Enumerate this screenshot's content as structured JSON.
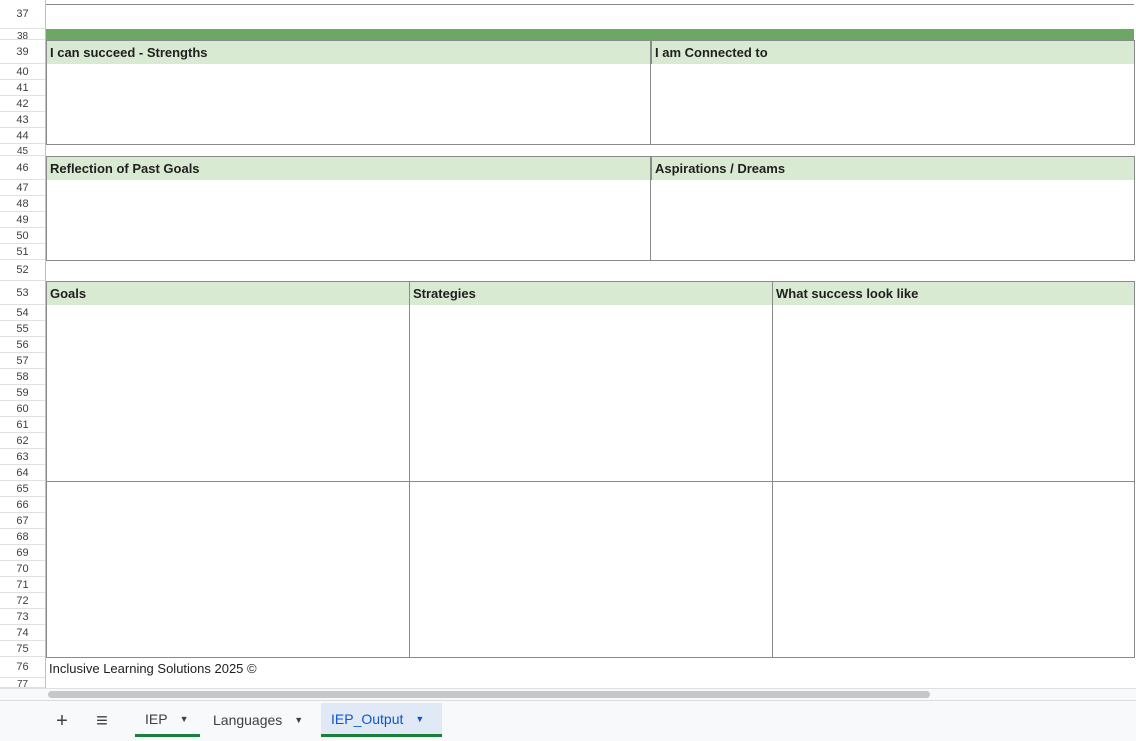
{
  "rows": [
    "37",
    "38",
    "39",
    "40",
    "41",
    "42",
    "43",
    "44",
    "45",
    "46",
    "47",
    "48",
    "49",
    "50",
    "51",
    "52",
    "53",
    "54",
    "55",
    "56",
    "57",
    "58",
    "59",
    "60",
    "61",
    "62",
    "63",
    "64",
    "65",
    "66",
    "67",
    "68",
    "69",
    "70",
    "71",
    "72",
    "73",
    "74",
    "75",
    "76",
    "77"
  ],
  "sections": {
    "strengths": "I can succeed - Strengths",
    "connected": "I am Connected to",
    "reflection": "Reflection of Past Goals",
    "aspirations": "Aspirations / Dreams",
    "goals": "Goals",
    "strategies": "Strategies",
    "success": "What success look like"
  },
  "footer": "Inclusive Learning Solutions  2025 ©",
  "tabbar": {
    "add_label": "+",
    "menu_label": "≡",
    "tabs": [
      {
        "label": "IEP"
      },
      {
        "label": "Languages"
      },
      {
        "label": "IEP_Output"
      }
    ],
    "caret": "▼"
  },
  "colors": {
    "green_bar": "#6aa864",
    "header_fill": "#d9ead3",
    "active_tab_text": "#0b57d0",
    "active_tab_bg": "#e1e9f7",
    "tab_underline": "#188038"
  }
}
